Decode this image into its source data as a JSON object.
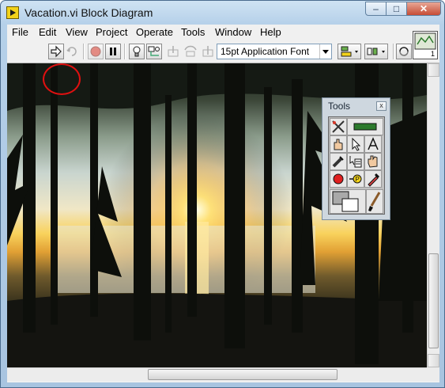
{
  "window": {
    "title": "Vacation.vi Block Diagram",
    "caption_buttons": {
      "minimize": "–",
      "maximize": "□",
      "close": "✕"
    }
  },
  "menu": [
    {
      "label": "File"
    },
    {
      "label": "Edit"
    },
    {
      "label": "View"
    },
    {
      "label": "Project"
    },
    {
      "label": "Operate"
    },
    {
      "label": "Tools"
    },
    {
      "label": "Window"
    },
    {
      "label": "Help"
    }
  ],
  "toolbar": {
    "buttons": [
      {
        "icon": "run-arrow-icon",
        "enabled": true,
        "highlighted": true
      },
      {
        "icon": "run-continuously-icon",
        "enabled": false
      },
      {
        "icon": "abort-icon",
        "enabled": false
      },
      {
        "icon": "pause-icon",
        "enabled": true
      },
      {
        "icon": "highlight-execution-icon",
        "enabled": true
      },
      {
        "icon": "retain-wire-values-icon",
        "enabled": true
      },
      {
        "icon": "step-into-icon",
        "enabled": false
      },
      {
        "icon": "step-over-icon",
        "enabled": false
      },
      {
        "icon": "step-out-icon",
        "enabled": false
      }
    ],
    "font_select": "15pt Application Font",
    "vi_icon_label": "1"
  },
  "tools_palette": {
    "title": "Tools",
    "close_label": "x",
    "tools": [
      "automatic-tool-icon",
      "auto-select-led-icon",
      "operate-value-icon",
      "position-select-icon",
      "edit-text-icon",
      "connect-wire-icon",
      "object-shortcut-menu-icon",
      "scroll-window-icon",
      "set-breakpoint-icon",
      "probe-data-icon",
      "get-color-icon",
      "set-color-icon",
      "paintbrush-icon"
    ]
  },
  "colors": {
    "highlight_circle": "#e01010",
    "abort_button": "#d93a2b",
    "auto_led": "#2c7a2c"
  }
}
